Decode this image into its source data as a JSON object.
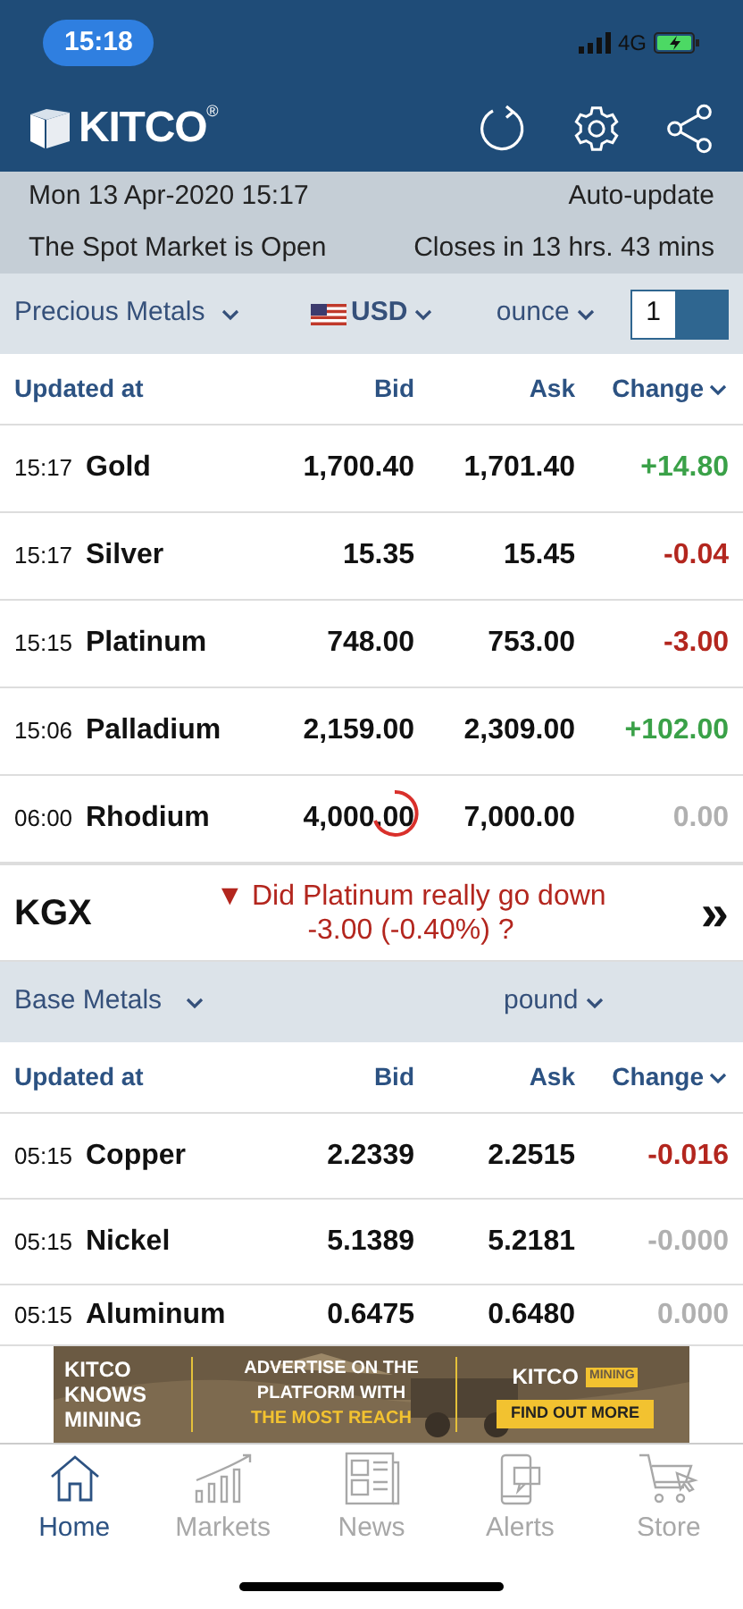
{
  "status_bar": {
    "time": "15:18",
    "network": "4G"
  },
  "header": {
    "logo": "KITCO",
    "registered": "®"
  },
  "info": {
    "datetime": "Mon 13 Apr-2020 15:17",
    "auto_update": "Auto-update",
    "market_status": "The Spot Market is Open",
    "closes": "Closes in 13 hrs. 43 mins"
  },
  "precious": {
    "category": "Precious Metals",
    "currency": "USD",
    "unit": "ounce",
    "quantity": "1",
    "columns": [
      "Updated at",
      "Bid",
      "Ask",
      "Change"
    ],
    "rows": [
      {
        "time": "15:17",
        "name": "Gold",
        "bid": "1,700.40",
        "ask": "1,701.40",
        "change": "+14.80",
        "kind": "up",
        "refreshing": false
      },
      {
        "time": "15:17",
        "name": "Silver",
        "bid": "15.35",
        "ask": "15.45",
        "change": "-0.04",
        "kind": "down",
        "refreshing": false
      },
      {
        "time": "15:15",
        "name": "Platinum",
        "bid": "748.00",
        "ask": "753.00",
        "change": "-3.00",
        "kind": "down",
        "refreshing": false
      },
      {
        "time": "15:06",
        "name": "Palladium",
        "bid": "2,159.00",
        "ask": "2,309.00",
        "change": "+102.00",
        "kind": "up",
        "refreshing": false
      },
      {
        "time": "06:00",
        "name": "Rhodium",
        "bid": "4,000.00",
        "ask": "7,000.00",
        "change": "0.00",
        "kind": "flat",
        "refreshing": true
      }
    ]
  },
  "kgx": {
    "label": "KGX",
    "arrow": "▼",
    "question": "Did Platinum really go down",
    "figure": "-3.00 (-0.40%) ?",
    "more": "»"
  },
  "base": {
    "category": "Base Metals",
    "unit": "pound",
    "columns": [
      "Updated at",
      "Bid",
      "Ask",
      "Change"
    ],
    "rows": [
      {
        "time": "05:15",
        "name": "Copper",
        "bid": "2.2339",
        "ask": "2.2515",
        "change": "-0.016",
        "kind": "down"
      },
      {
        "time": "05:15",
        "name": "Nickel",
        "bid": "5.1389",
        "ask": "5.2181",
        "change": "-0.000",
        "kind": "flat"
      },
      {
        "time": "05:15",
        "name": "Aluminum",
        "bid": "0.6475",
        "ask": "0.6480",
        "change": "0.000",
        "kind": "flat"
      }
    ]
  },
  "ad": {
    "left": [
      "KITCO",
      "KNOWS",
      "MINING"
    ],
    "middle": [
      "ADVERTISE ON THE",
      "PLATFORM WITH"
    ],
    "highlight": "THE MOST REACH",
    "brand": "KITCO",
    "brand_tag": "MINING",
    "cta": "FIND OUT MORE"
  },
  "tabs": [
    {
      "label": "Home",
      "selected": true
    },
    {
      "label": "Markets",
      "selected": false
    },
    {
      "label": "News",
      "selected": false
    },
    {
      "label": "Alerts",
      "selected": false
    },
    {
      "label": "Store",
      "selected": false
    }
  ]
}
